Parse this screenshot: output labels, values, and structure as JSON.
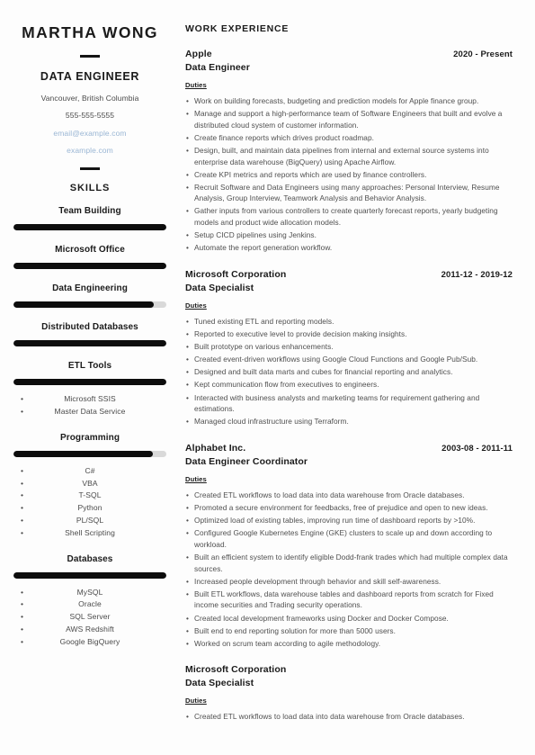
{
  "document": {
    "type": "resume",
    "accent_color": "#0d0d0d",
    "link_color": "#9ab6d4",
    "text_color": "#4f4f4f"
  },
  "sidebar": {
    "name": "MARTHA WONG",
    "title": "DATA ENGINEER",
    "location": "Vancouver, British Columbia",
    "phone": "555-555-5555",
    "email": "email@example.com",
    "website": "example.com",
    "skills_heading": "SKILLS",
    "skills": [
      {
        "name": "Team Building",
        "level": 100
      },
      {
        "name": "Microsoft Office",
        "level": 100
      },
      {
        "name": "Data Engineering",
        "level": 92
      },
      {
        "name": "Distributed Databases",
        "level": 100
      },
      {
        "name": "ETL Tools",
        "level": 100,
        "items": [
          "Microsoft SSIS",
          "Master Data Service"
        ]
      },
      {
        "name": "Programming",
        "level": 91,
        "items": [
          "C#",
          "VBA",
          "T-SQL",
          "Python",
          "PL/SQL",
          "Shell Scripting"
        ]
      },
      {
        "name": "Databases",
        "level": 100,
        "items": [
          "MySQL",
          "Oracle",
          "SQL Server",
          "AWS Redshift",
          "Google BigQuery"
        ]
      }
    ]
  },
  "main": {
    "section_title": "WORK EXPERIENCE",
    "duties_label": "Duties",
    "jobs": [
      {
        "company": "Apple",
        "role": "Data Engineer",
        "dates": "2020 - Present",
        "duties": [
          "Work on building forecasts, budgeting and prediction models for Apple finance group.",
          "Manage and support a high-performance team of Software Engineers that built and evolve a distributed cloud system of customer information.",
          "Create finance reports which drives product roadmap.",
          "Design, built, and maintain data pipelines from internal and external source systems into enterprise data warehouse (BigQuery) using Apache Airflow.",
          "Create KPI metrics and reports which are used by finance controllers.",
          "Recruit Software and Data Engineers using many approaches: Personal Interview, Resume Analysis, Group Interview, Teamwork Analysis and Behavior Analysis.",
          "Gather inputs from various controllers to create quarterly forecast reports, yearly budgeting models and product wide allocation models.",
          "Setup CICD pipelines using Jenkins.",
          "Automate the report generation workflow."
        ]
      },
      {
        "company": "Microsoft Corporation",
        "role": "Data Specialist",
        "dates": "2011-12 - 2019-12",
        "duties": [
          "Tuned existing ETL and reporting models.",
          "Reported to executive level to provide decision making insights.",
          "Built prototype on various enhancements.",
          "Created event-driven workflows using Google Cloud Functions and Google Pub/Sub.",
          "Designed and built data marts and cubes for financial reporting and analytics.",
          "Kept communication flow from executives to engineers.",
          "Interacted with business analysts and marketing teams for requirement gathering and estimations.",
          "Managed cloud infrastructure using Terraform."
        ]
      },
      {
        "company": "Alphabet Inc.",
        "role": "Data Engineer Coordinator",
        "dates": "2003-08 - 2011-11",
        "duties": [
          "Created ETL workflows to load data into data warehouse from Oracle databases.",
          "Promoted a secure environment for feedbacks, free of prejudice and open to new ideas.",
          "Optimized load of existing tables, improving run time of dashboard reports by >10%.",
          "Configured Google Kubernetes Engine (GKE) clusters to scale up and down according to workload.",
          "Built an efficient system to identify eligible Dodd-frank trades which had multiple complex data sources.",
          "Increased people development through behavior and skill self-awareness.",
          "Built ETL workflows, data warehouse tables and dashboard reports from scratch for Fixed income securities and Trading security operations.",
          "Created local development frameworks using Docker and Docker Compose.",
          "Built end to end reporting solution for more than 5000 users.",
          "Worked on scrum team according to agile methodology."
        ]
      },
      {
        "company": "Microsoft Corporation",
        "role": "Data Specialist",
        "dates": "",
        "duties": [
          "Created ETL workflows to load data into data warehouse from Oracle databases."
        ]
      }
    ]
  }
}
